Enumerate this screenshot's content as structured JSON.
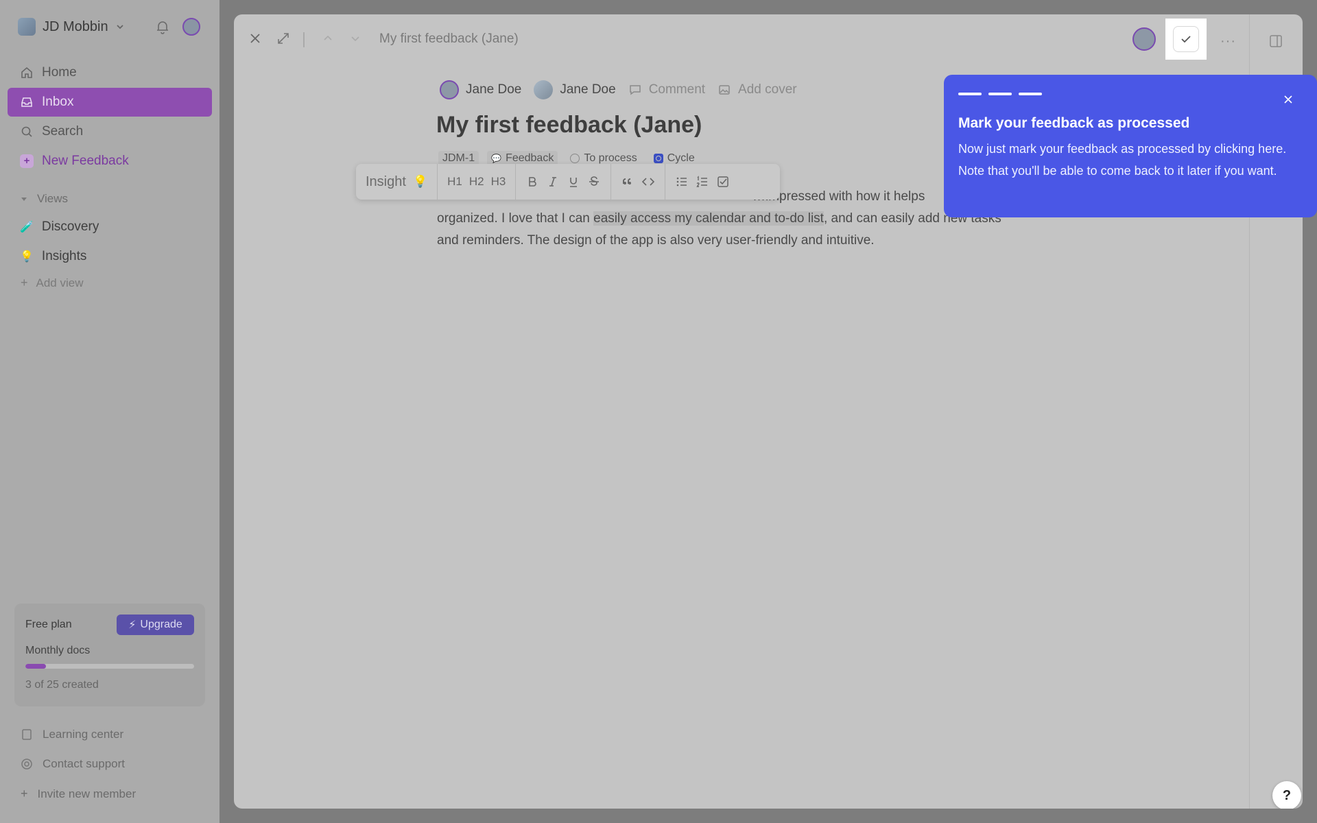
{
  "sidebar": {
    "workspace_name": "JD Mobbin",
    "nav": [
      {
        "label": "Home",
        "icon": "home-icon"
      },
      {
        "label": "Inbox",
        "icon": "inbox-icon",
        "active": true
      },
      {
        "label": "Search",
        "icon": "search-icon"
      },
      {
        "label": "New Feedback",
        "icon": "plus-icon"
      }
    ],
    "views_label": "Views",
    "views": [
      {
        "label": "Discovery",
        "emoji": "🧪"
      },
      {
        "label": "Insights",
        "emoji": "💡"
      }
    ],
    "add_view_label": "Add view",
    "plan": {
      "title": "Free plan",
      "upgrade_label": "Upgrade",
      "docs_label": "Monthly docs",
      "used": 3,
      "limit": 25,
      "progress_fraction": 0.12,
      "count_text": "3 of 25 created"
    },
    "footer": [
      {
        "label": "Learning center",
        "icon": "book-icon"
      },
      {
        "label": "Contact support",
        "icon": "lifebuoy-icon"
      },
      {
        "label": "Invite new member",
        "icon": "plus-icon"
      }
    ]
  },
  "document": {
    "header_title": "My first feedback (Jane)",
    "meta": {
      "author": "Jane Doe",
      "assignee": "Jane Doe",
      "comment_label": "Comment",
      "add_cover_label": "Add cover"
    },
    "title": "My first feedback (Jane)",
    "tags": {
      "id": "JDM-1",
      "type": "Feedback",
      "status": "To process",
      "cycle": "Cycle"
    },
    "toolbar": {
      "insight_label": "Insight",
      "insight_emoji": "💡",
      "h1": "H1",
      "h2": "H2",
      "h3": "H3"
    },
    "body": {
      "line1_visible": "…impressed with how it helps",
      "line2_pre": "organized. I love that I can ",
      "line2_highlight": "easily access my calendar and to-do list",
      "line2_post": ", and can easily add new tasks",
      "line3": "and reminders. The design of the app is also very user-friendly and intuitive."
    }
  },
  "tooltip": {
    "title": "Mark your feedback as processed",
    "text": "Now just mark your feedback as processed by clicking here. Note that you'll be able to come back to it later if you want.",
    "steps": 3
  },
  "help_label": "?",
  "colors": {
    "accent_purple": "#8e4eb0",
    "tooltip_blue": "#4a57e6",
    "upgrade_blue": "#5a51a9"
  }
}
